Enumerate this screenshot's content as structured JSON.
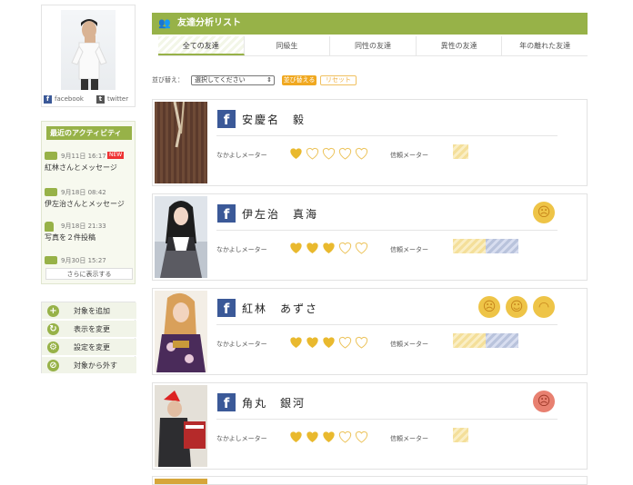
{
  "profile": {
    "sns": [
      {
        "icon": "facebook-icon",
        "label": "facebook"
      },
      {
        "icon": "twitter-icon",
        "label": "twitter"
      }
    ]
  },
  "activity": {
    "title": "最近のアクティビティ",
    "items": [
      {
        "time": "9月11日 16:17",
        "text": "紅林さんとメッセージ",
        "new": "NEW"
      },
      {
        "time": "9月18日 08:42",
        "text": "伊左治さんとメッセージ"
      },
      {
        "time": "9月18日 21:33",
        "text": "写真を２件投稿"
      },
      {
        "time": "9月30日 15:27",
        "text": ""
      }
    ],
    "more": "さらに表示する"
  },
  "actions": [
    "対象を追加",
    "表示を変更",
    "設定を変更",
    "対象から外す"
  ],
  "main": {
    "title": "友達分析リスト",
    "tabs": [
      "全ての友達",
      "同級生",
      "同性の友達",
      "異性の友達",
      "年の離れた友達"
    ],
    "sort_label": "並び替え：",
    "sort_select": "選択してください",
    "sort_button": "並び替える",
    "reset_button": "リセット"
  },
  "labels": {
    "nakayoshi": "なかよしメーター",
    "shinrai": "信頼メーター"
  },
  "friends": [
    {
      "name": "安慶名　毅",
      "hearts": 1,
      "trust": "1 short yellow segment",
      "faces": []
    },
    {
      "name": "伊左治　真海",
      "hearts": 3,
      "trust": "yellow + blue segments",
      "faces": [
        "sad"
      ]
    },
    {
      "name": "紅林　あずさ",
      "hearts": 3,
      "trust": "yellow + blue segments",
      "faces": [
        "sad",
        "surprised",
        "happy"
      ]
    },
    {
      "name": "角丸　銀河",
      "hearts": 3,
      "trust": "1 short yellow segment",
      "faces": [
        "angry"
      ]
    }
  ],
  "colors": {
    "accent": "#97b248",
    "fb": "#3b5998",
    "heart": "#e9b92e",
    "orange": "#f0a820"
  }
}
